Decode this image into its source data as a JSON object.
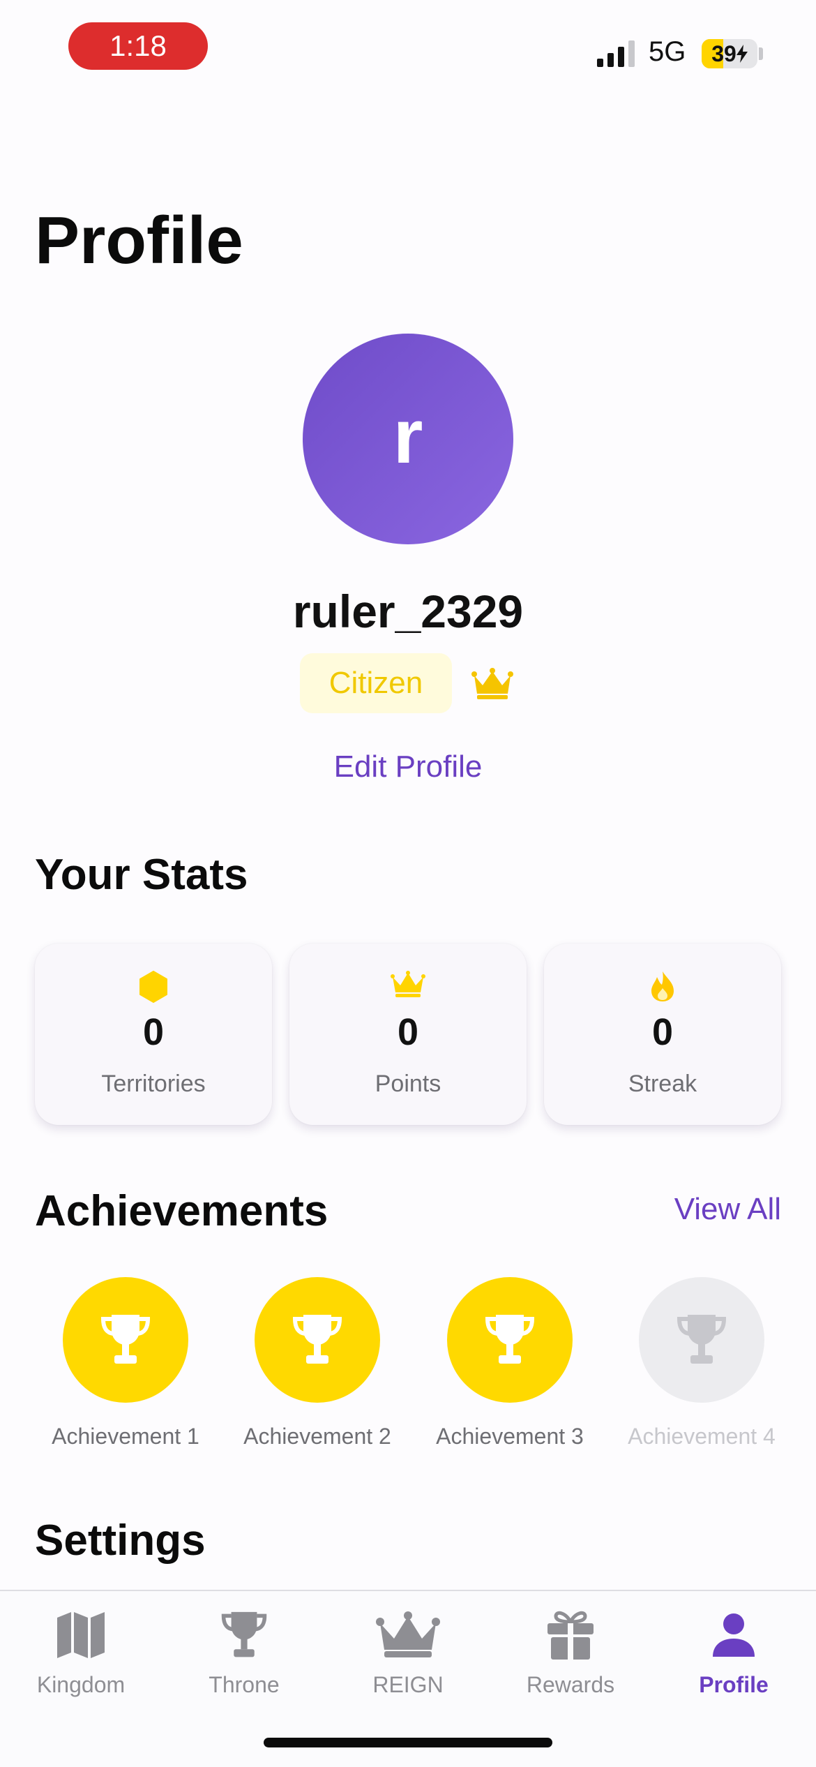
{
  "status_bar": {
    "time": "1:18",
    "network": "5G",
    "battery": "39",
    "battery_level": 0.39,
    "colors": {
      "time_pill": "#dd2d2d",
      "battery_fill": "#ffd400"
    }
  },
  "page": {
    "title": "Profile"
  },
  "profile": {
    "avatar_letter": "r",
    "username": "ruler_2329",
    "rank": "Citizen",
    "edit_label": "Edit Profile",
    "colors": {
      "avatar": "#7b55d6",
      "accent": "#6a3fc2",
      "gold": "#ffd900"
    }
  },
  "stats": {
    "title": "Your Stats",
    "cards": [
      {
        "icon": "hexagon-icon",
        "value": "0",
        "label": "Territories"
      },
      {
        "icon": "crown-icon",
        "value": "0",
        "label": "Points"
      },
      {
        "icon": "flame-icon",
        "value": "0",
        "label": "Streak"
      }
    ]
  },
  "achievements": {
    "title": "Achievements",
    "view_all": "View All",
    "items": [
      {
        "label": "Achievement 1",
        "icon": "trophy-icon",
        "earned": true
      },
      {
        "label": "Achievement 2",
        "icon": "trophy-icon",
        "earned": true
      },
      {
        "label": "Achievement 3",
        "icon": "trophy-icon",
        "earned": true
      },
      {
        "label": "Achievement 4",
        "icon": "trophy-icon",
        "earned": false
      }
    ]
  },
  "settings": {
    "title": "Settings"
  },
  "tab_bar": {
    "tabs": [
      {
        "label": "Kingdom",
        "icon": "map-icon",
        "active": false
      },
      {
        "label": "Throne",
        "icon": "trophy-icon",
        "active": false
      },
      {
        "label": "REIGN",
        "icon": "crown-icon",
        "active": false
      },
      {
        "label": "Rewards",
        "icon": "gift-icon",
        "active": false
      },
      {
        "label": "Profile",
        "icon": "person-icon",
        "active": true
      }
    ]
  }
}
